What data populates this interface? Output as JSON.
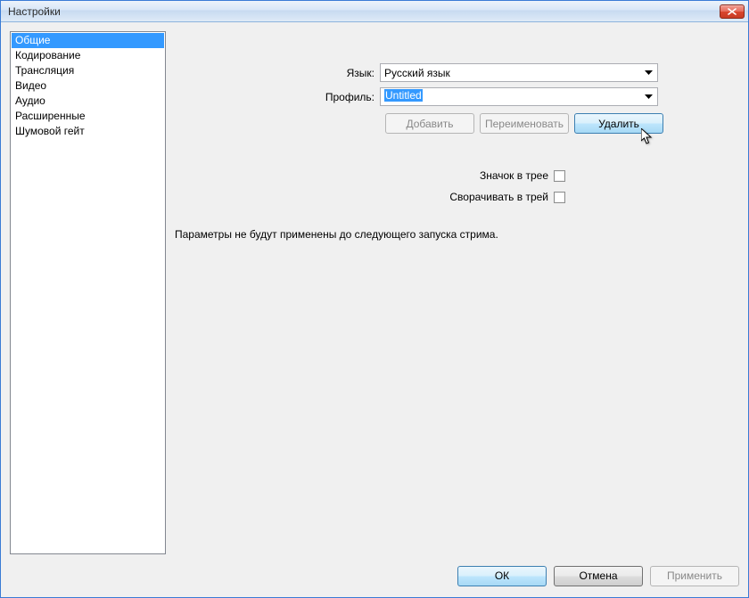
{
  "window": {
    "title": "Настройки"
  },
  "sidebar": {
    "items": [
      "Общие",
      "Кодирование",
      "Трансляция",
      "Видео",
      "Аудио",
      "Расширенные",
      "Шумовой гейт"
    ],
    "selected_index": 0
  },
  "form": {
    "language_label": "Язык:",
    "language_value": "Русский язык",
    "profile_label": "Профиль:",
    "profile_value": "Untitled",
    "add_label": "Добавить",
    "rename_label": "Переименовать",
    "delete_label": "Удалить",
    "tray_icon_label": "Значок в трее",
    "minimize_tray_label": "Сворачивать в трей",
    "tray_icon_checked": false,
    "minimize_tray_checked": false,
    "info_text": "Параметры не будут применены до следующего запуска стрима."
  },
  "footer": {
    "ok": "ОК",
    "cancel": "Отмена",
    "apply": "Применить"
  }
}
